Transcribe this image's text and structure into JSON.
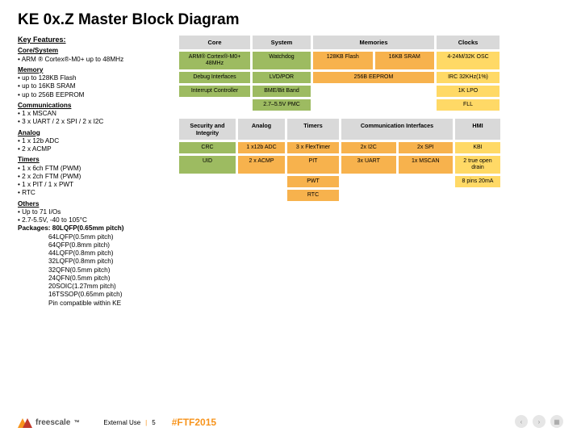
{
  "title": "KE 0x.Z Master Block Diagram",
  "features": {
    "heading": "Key Features:",
    "core_h": "Core/System",
    "core_1": "• ARM ® Cortex®-M0+ up to 48MHz",
    "mem_h": "Memory",
    "mem_1": "• up to 128KB Flash",
    "mem_2": "• up to 16KB SRAM",
    "mem_3": "• up to 256B EEPROM",
    "com_h": "Communications",
    "com_1": "• 1 x MSCAN",
    "com_2": "• 3 x UART / 2 x SPI / 2 x I2C",
    "ana_h": "Analog",
    "ana_1": "• 1 x 12b ADC",
    "ana_2": "• 2 x ACMP",
    "tim_h": "Timers",
    "tim_1": "• 1 x 6ch FTM (PWM)",
    "tim_2": "• 2 x 2ch FTM (PWM)",
    "tim_3": "• 1 x PIT / 1 x PWT",
    "tim_4": "• RTC",
    "oth_h": "Others",
    "oth_1": "• Up to 71 I/Os",
    "oth_2": "• 2.7-5.5V, -40 to 105°C",
    "pkg_h": "Packages: 80LQFP(0.65mm pitch)",
    "pkg_1": "64LQFP(0.5mm pitch)",
    "pkg_2": "64QFP(0.8mm pitch)",
    "pkg_3": "44LQFP(0.8mm pitch)",
    "pkg_4": "32LQFP(0.8mm pitch)",
    "pkg_5": "32QFN(0.5mm pitch)",
    "pkg_6": "24QFN(0.5mm pitch)",
    "pkg_7": "20SOIC(1.27mm pitch)",
    "pkg_8": "16TSSOP(0.65mm pitch)",
    "pkg_9": "Pin compatible within KE"
  },
  "diag": {
    "h_core": "Core",
    "h_sys": "System",
    "h_mem": "Memories",
    "h_clk": "Clocks",
    "core_1": "ARM® Cortex®-M0+ 48MHz",
    "core_2": "Debug Interfaces",
    "core_3": "Interrupt Controller",
    "sys_1": "Watchdog",
    "sys_2": "LVD/POR",
    "sys_3": "BME/Bit Band",
    "sys_4": "2.7–5.5V PMC",
    "mem_1": "128KB Flash",
    "mem_2": "16KB SRAM",
    "mem_3": "256B EEPROM",
    "clk_1": "4-24M/32K OSC",
    "clk_2": "IRC 32KHz(1%)",
    "clk_3": "1K LPO",
    "clk_4": "FLL",
    "h2_sec": "Security and Integrity",
    "h2_ana": "Analog",
    "h2_tim": "Timers",
    "h2_com": "Communication Interfaces",
    "h2_hmi": "HMI",
    "sec_1": "CRC",
    "sec_2": "UID",
    "an_1": "1 x12b ADC",
    "an_2": "2 x ACMP",
    "tm_1": "3 x FlexTimer",
    "tm_2": "PIT",
    "tm_3": "PWT",
    "tm_4": "RTC",
    "ci_1": "2x I2C",
    "ci_2": "2x SPI",
    "ci_3": "3x UART",
    "ci_4": "1x MSCAN",
    "hm_1": "KBI",
    "hm_2": "2 true open drain",
    "hm_3": "8 pins 20mA"
  },
  "footer": {
    "brand": "freescale",
    "ext": "External Use",
    "page": "5",
    "tag": "#FTF2015"
  }
}
